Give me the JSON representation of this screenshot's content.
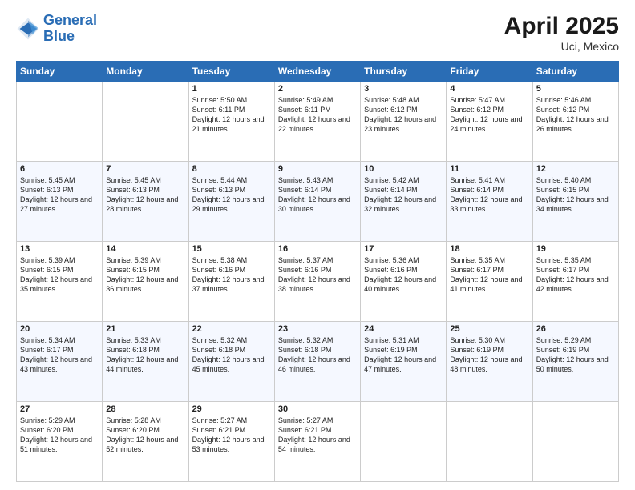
{
  "logo": {
    "line1": "General",
    "line2": "Blue"
  },
  "title": "April 2025",
  "location": "Uci, Mexico",
  "weekdays": [
    "Sunday",
    "Monday",
    "Tuesday",
    "Wednesday",
    "Thursday",
    "Friday",
    "Saturday"
  ],
  "weeks": [
    [
      {
        "day": "",
        "info": ""
      },
      {
        "day": "",
        "info": ""
      },
      {
        "day": "1",
        "info": "Sunrise: 5:50 AM\nSunset: 6:11 PM\nDaylight: 12 hours and 21 minutes."
      },
      {
        "day": "2",
        "info": "Sunrise: 5:49 AM\nSunset: 6:11 PM\nDaylight: 12 hours and 22 minutes."
      },
      {
        "day": "3",
        "info": "Sunrise: 5:48 AM\nSunset: 6:12 PM\nDaylight: 12 hours and 23 minutes."
      },
      {
        "day": "4",
        "info": "Sunrise: 5:47 AM\nSunset: 6:12 PM\nDaylight: 12 hours and 24 minutes."
      },
      {
        "day": "5",
        "info": "Sunrise: 5:46 AM\nSunset: 6:12 PM\nDaylight: 12 hours and 26 minutes."
      }
    ],
    [
      {
        "day": "6",
        "info": "Sunrise: 5:45 AM\nSunset: 6:13 PM\nDaylight: 12 hours and 27 minutes."
      },
      {
        "day": "7",
        "info": "Sunrise: 5:45 AM\nSunset: 6:13 PM\nDaylight: 12 hours and 28 minutes."
      },
      {
        "day": "8",
        "info": "Sunrise: 5:44 AM\nSunset: 6:13 PM\nDaylight: 12 hours and 29 minutes."
      },
      {
        "day": "9",
        "info": "Sunrise: 5:43 AM\nSunset: 6:14 PM\nDaylight: 12 hours and 30 minutes."
      },
      {
        "day": "10",
        "info": "Sunrise: 5:42 AM\nSunset: 6:14 PM\nDaylight: 12 hours and 32 minutes."
      },
      {
        "day": "11",
        "info": "Sunrise: 5:41 AM\nSunset: 6:14 PM\nDaylight: 12 hours and 33 minutes."
      },
      {
        "day": "12",
        "info": "Sunrise: 5:40 AM\nSunset: 6:15 PM\nDaylight: 12 hours and 34 minutes."
      }
    ],
    [
      {
        "day": "13",
        "info": "Sunrise: 5:39 AM\nSunset: 6:15 PM\nDaylight: 12 hours and 35 minutes."
      },
      {
        "day": "14",
        "info": "Sunrise: 5:39 AM\nSunset: 6:15 PM\nDaylight: 12 hours and 36 minutes."
      },
      {
        "day": "15",
        "info": "Sunrise: 5:38 AM\nSunset: 6:16 PM\nDaylight: 12 hours and 37 minutes."
      },
      {
        "day": "16",
        "info": "Sunrise: 5:37 AM\nSunset: 6:16 PM\nDaylight: 12 hours and 38 minutes."
      },
      {
        "day": "17",
        "info": "Sunrise: 5:36 AM\nSunset: 6:16 PM\nDaylight: 12 hours and 40 minutes."
      },
      {
        "day": "18",
        "info": "Sunrise: 5:35 AM\nSunset: 6:17 PM\nDaylight: 12 hours and 41 minutes."
      },
      {
        "day": "19",
        "info": "Sunrise: 5:35 AM\nSunset: 6:17 PM\nDaylight: 12 hours and 42 minutes."
      }
    ],
    [
      {
        "day": "20",
        "info": "Sunrise: 5:34 AM\nSunset: 6:17 PM\nDaylight: 12 hours and 43 minutes."
      },
      {
        "day": "21",
        "info": "Sunrise: 5:33 AM\nSunset: 6:18 PM\nDaylight: 12 hours and 44 minutes."
      },
      {
        "day": "22",
        "info": "Sunrise: 5:32 AM\nSunset: 6:18 PM\nDaylight: 12 hours and 45 minutes."
      },
      {
        "day": "23",
        "info": "Sunrise: 5:32 AM\nSunset: 6:18 PM\nDaylight: 12 hours and 46 minutes."
      },
      {
        "day": "24",
        "info": "Sunrise: 5:31 AM\nSunset: 6:19 PM\nDaylight: 12 hours and 47 minutes."
      },
      {
        "day": "25",
        "info": "Sunrise: 5:30 AM\nSunset: 6:19 PM\nDaylight: 12 hours and 48 minutes."
      },
      {
        "day": "26",
        "info": "Sunrise: 5:29 AM\nSunset: 6:19 PM\nDaylight: 12 hours and 50 minutes."
      }
    ],
    [
      {
        "day": "27",
        "info": "Sunrise: 5:29 AM\nSunset: 6:20 PM\nDaylight: 12 hours and 51 minutes."
      },
      {
        "day": "28",
        "info": "Sunrise: 5:28 AM\nSunset: 6:20 PM\nDaylight: 12 hours and 52 minutes."
      },
      {
        "day": "29",
        "info": "Sunrise: 5:27 AM\nSunset: 6:21 PM\nDaylight: 12 hours and 53 minutes."
      },
      {
        "day": "30",
        "info": "Sunrise: 5:27 AM\nSunset: 6:21 PM\nDaylight: 12 hours and 54 minutes."
      },
      {
        "day": "",
        "info": ""
      },
      {
        "day": "",
        "info": ""
      },
      {
        "day": "",
        "info": ""
      }
    ]
  ]
}
